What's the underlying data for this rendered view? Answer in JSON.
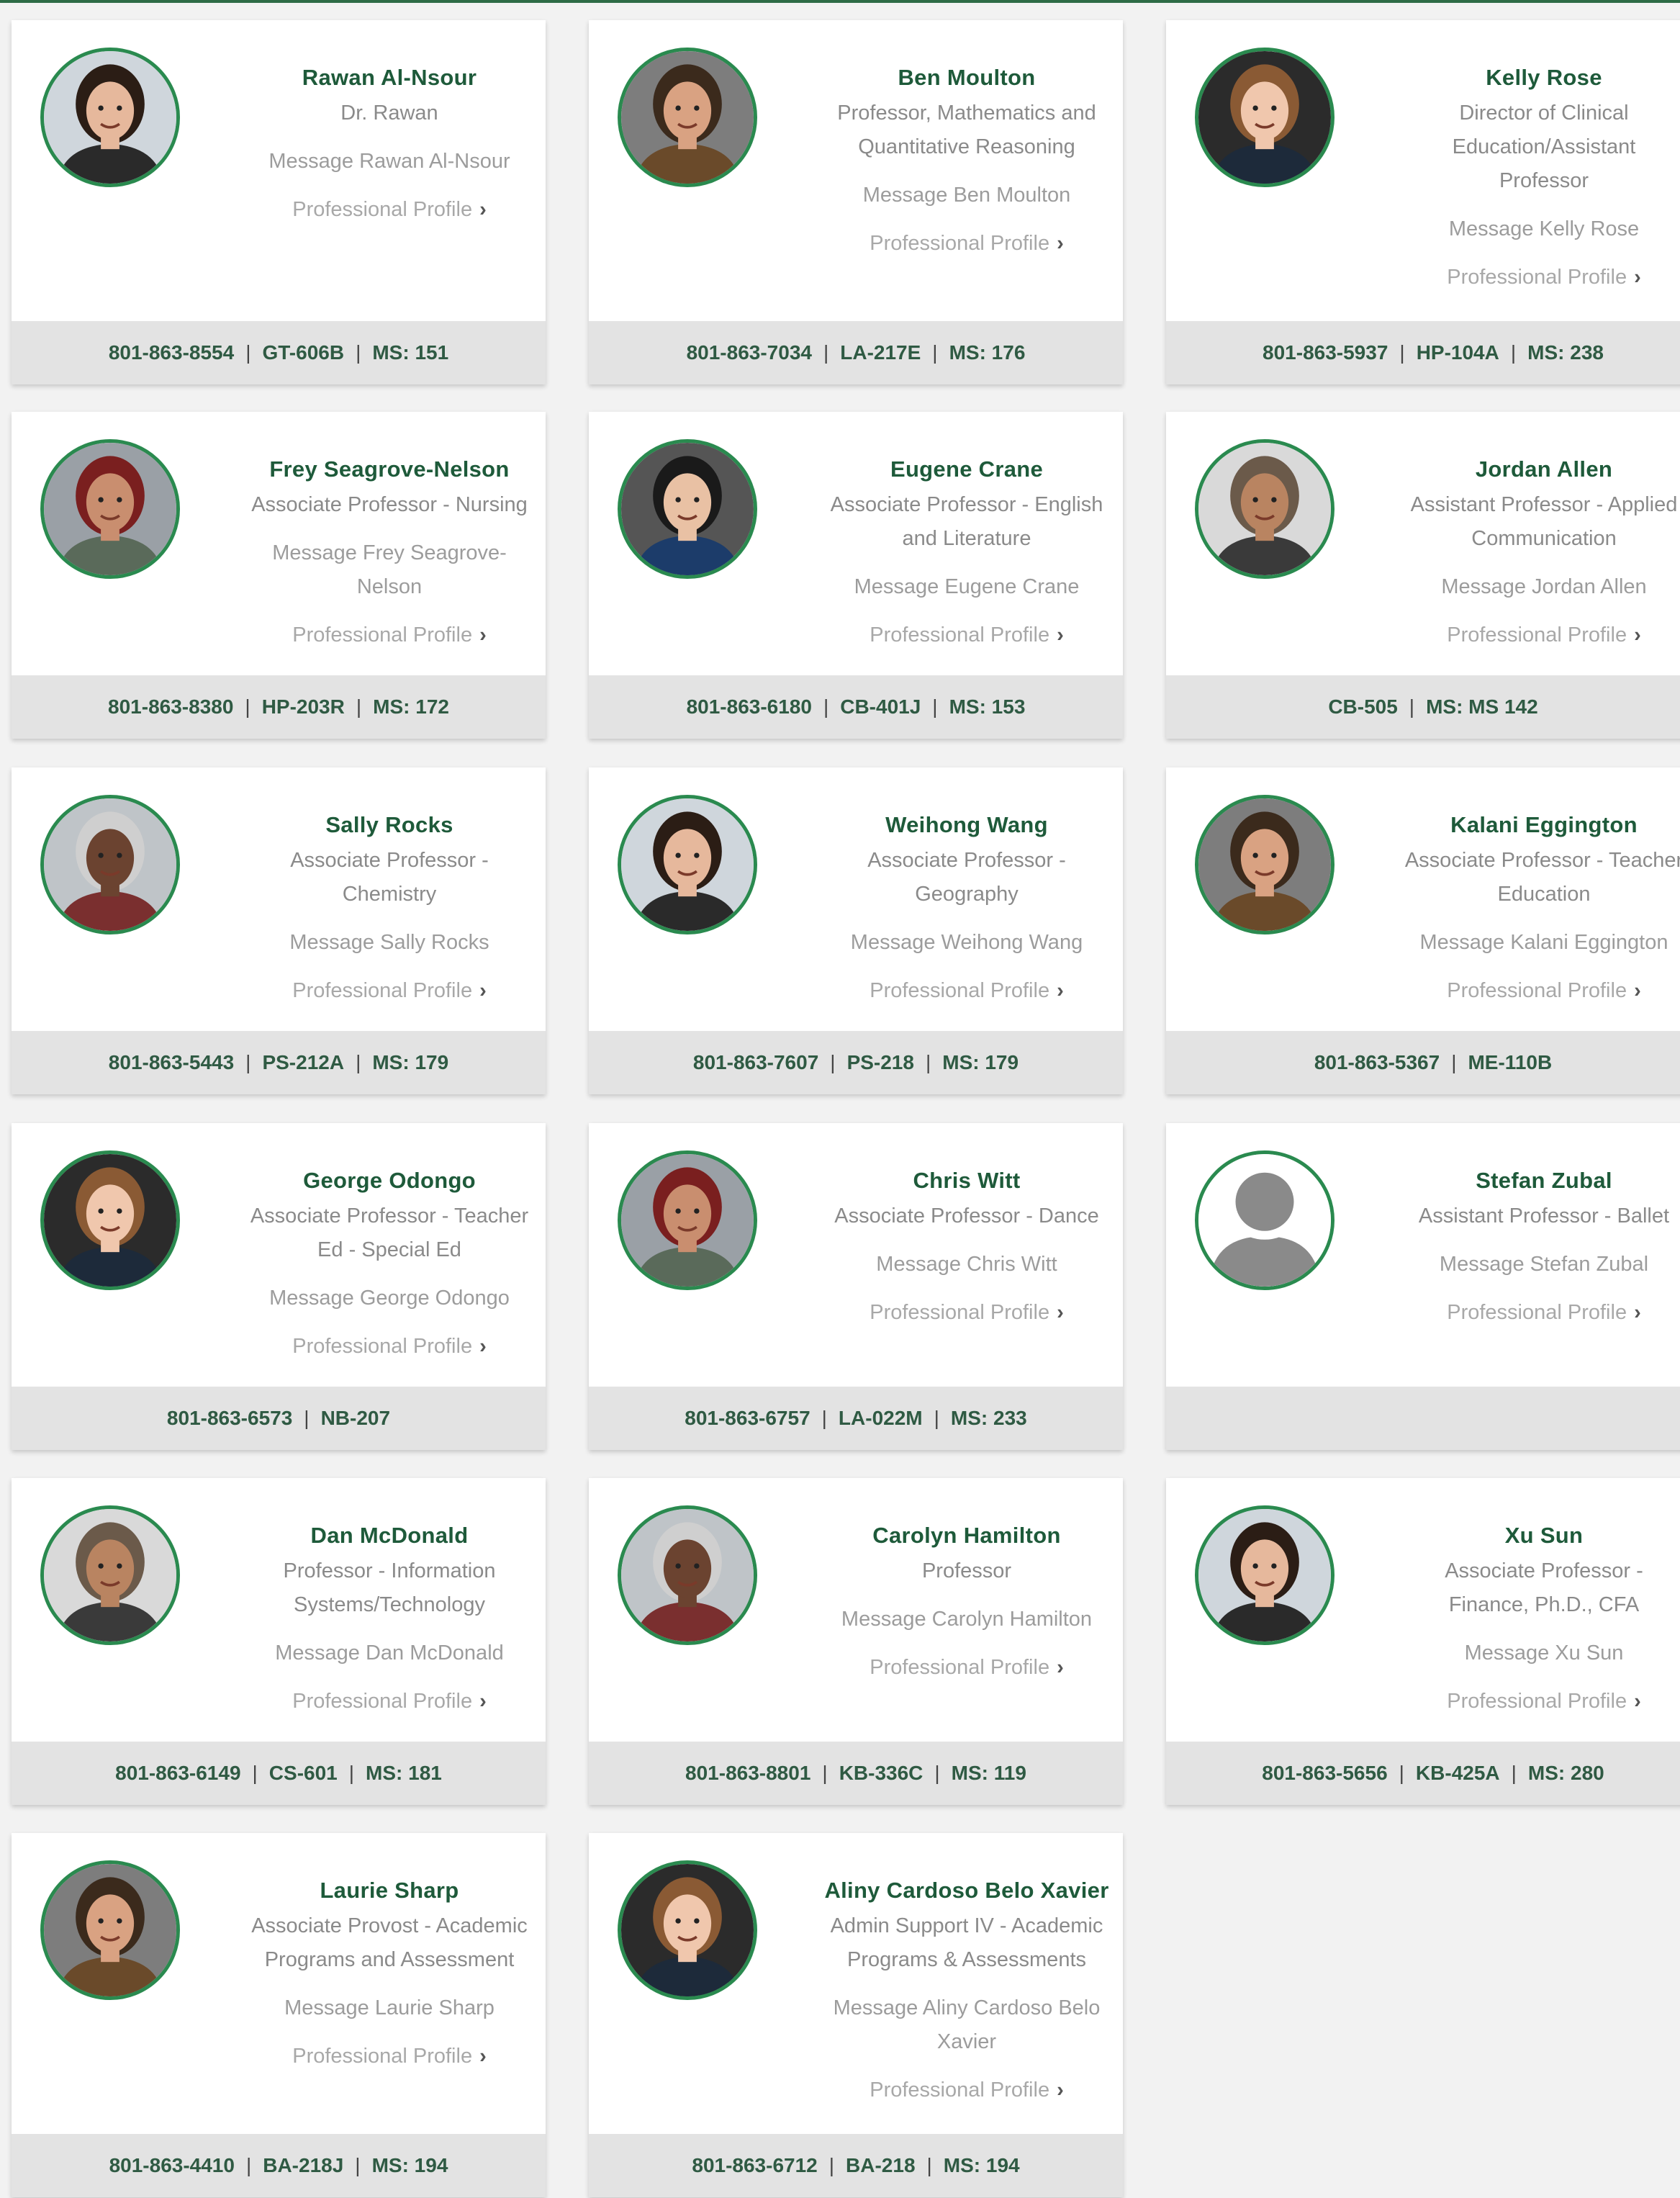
{
  "colors": {
    "accent": "#2a8a4f",
    "name": "#1e5a3a",
    "footer_bg": "#e3e3e3"
  },
  "profile_label": "Professional Profile",
  "people": [
    {
      "name": "Rawan Al-Nsour",
      "title": [
        "Dr. Rawan"
      ],
      "message": [
        "Message Rawan Al-Nsour"
      ],
      "footer": [
        "801-863-8554",
        "GT-606B",
        "MS: 151"
      ],
      "avatar": "avatar-photo"
    },
    {
      "name": "Ben Moulton",
      "title": [
        "Professor, Mathematics and",
        "Quantitative Reasoning"
      ],
      "message": [
        "Message Ben Moulton"
      ],
      "footer": [
        "801-863-7034",
        "LA-217E",
        "MS: 176"
      ],
      "avatar": "avatar-photo"
    },
    {
      "name": "Kelly Rose",
      "title": [
        "Director of Clinical",
        "Education/Assistant",
        "Professor"
      ],
      "message": [
        "Message Kelly Rose"
      ],
      "footer": [
        "801-863-5937",
        "HP-104A",
        "MS: 238"
      ],
      "avatar": "avatar-photo"
    },
    {
      "name": "Frey Seagrove-Nelson",
      "title": [
        "Associate Professor - Nursing"
      ],
      "message": [
        "Message Frey Seagrove-",
        "Nelson"
      ],
      "footer": [
        "801-863-8380",
        "HP-203R",
        "MS: 172"
      ],
      "avatar": "avatar-photo"
    },
    {
      "name": "Eugene Crane",
      "title": [
        "Associate Professor - English",
        "and Literature"
      ],
      "message": [
        "Message Eugene Crane"
      ],
      "footer": [
        "801-863-6180",
        "CB-401J",
        "MS: 153"
      ],
      "avatar": "avatar-photo"
    },
    {
      "name": "Jordan Allen",
      "title": [
        "Assistant Professor - Applied",
        "Communication"
      ],
      "message": [
        "Message Jordan Allen"
      ],
      "footer": [
        "CB-505",
        "MS: MS 142"
      ],
      "avatar": "avatar-photo"
    },
    {
      "name": "Sally Rocks",
      "title": [
        "Associate Professor -",
        "Chemistry"
      ],
      "message": [
        "Message Sally Rocks"
      ],
      "footer": [
        "801-863-5443",
        "PS-212A",
        "MS: 179"
      ],
      "avatar": "avatar-photo"
    },
    {
      "name": "Weihong Wang",
      "title": [
        "Associate Professor -",
        "Geography"
      ],
      "message": [
        "Message Weihong Wang"
      ],
      "footer": [
        "801-863-7607",
        "PS-218",
        "MS: 179"
      ],
      "avatar": "avatar-photo"
    },
    {
      "name": "Kalani Eggington",
      "title": [
        "Associate Professor - Teacher",
        "Education"
      ],
      "message": [
        "Message Kalani Eggington"
      ],
      "footer": [
        "801-863-5367",
        "ME-110B"
      ],
      "avatar": "avatar-photo"
    },
    {
      "name": "George Odongo",
      "title": [
        "Associate Professor - Teacher",
        "Ed - Special Ed"
      ],
      "message": [
        "Message George Odongo"
      ],
      "footer": [
        "801-863-6573",
        "NB-207"
      ],
      "avatar": "avatar-photo"
    },
    {
      "name": "Chris Witt",
      "title": [
        "Associate Professor - Dance"
      ],
      "message": [
        "Message Chris Witt"
      ],
      "footer": [
        "801-863-6757",
        "LA-022M",
        "MS: 233"
      ],
      "avatar": "avatar-photo"
    },
    {
      "name": "Stefan Zubal",
      "title": [
        "Assistant Professor - Ballet"
      ],
      "message": [
        "Message Stefan Zubal"
      ],
      "footer": [],
      "avatar": "avatar-placeholder"
    },
    {
      "name": "Dan McDonald",
      "title": [
        "Professor - Information",
        "Systems/Technology"
      ],
      "message": [
        "Message Dan McDonald"
      ],
      "footer": [
        "801-863-6149",
        "CS-601",
        "MS: 181"
      ],
      "avatar": "avatar-photo"
    },
    {
      "name": "Carolyn Hamilton",
      "title": [
        "Professor"
      ],
      "message": [
        "Message Carolyn Hamilton"
      ],
      "footer": [
        "801-863-8801",
        "KB-336C",
        "MS: 119"
      ],
      "avatar": "avatar-photo"
    },
    {
      "name": "Xu Sun",
      "title": [
        "Associate Professor -",
        "Finance, Ph.D., CFA"
      ],
      "message": [
        "Message Xu Sun"
      ],
      "footer": [
        "801-863-5656",
        "KB-425A",
        "MS: 280"
      ],
      "avatar": "avatar-photo"
    },
    {
      "name": "Laurie Sharp",
      "title": [
        "Associate Provost - Academic",
        "Programs and Assessment"
      ],
      "message": [
        "Message Laurie Sharp"
      ],
      "footer": [
        "801-863-4410",
        "BA-218J",
        "MS: 194"
      ],
      "avatar": "avatar-photo"
    },
    {
      "name": "Aliny Cardoso Belo Xavier",
      "title": [
        "Admin Support IV - Academic",
        "Programs & Assessments"
      ],
      "message": [
        "Message Aliny Cardoso Belo",
        "Xavier"
      ],
      "footer": [
        "801-863-6712",
        "BA-218",
        "MS: 194"
      ],
      "avatar": "avatar-photo"
    }
  ]
}
